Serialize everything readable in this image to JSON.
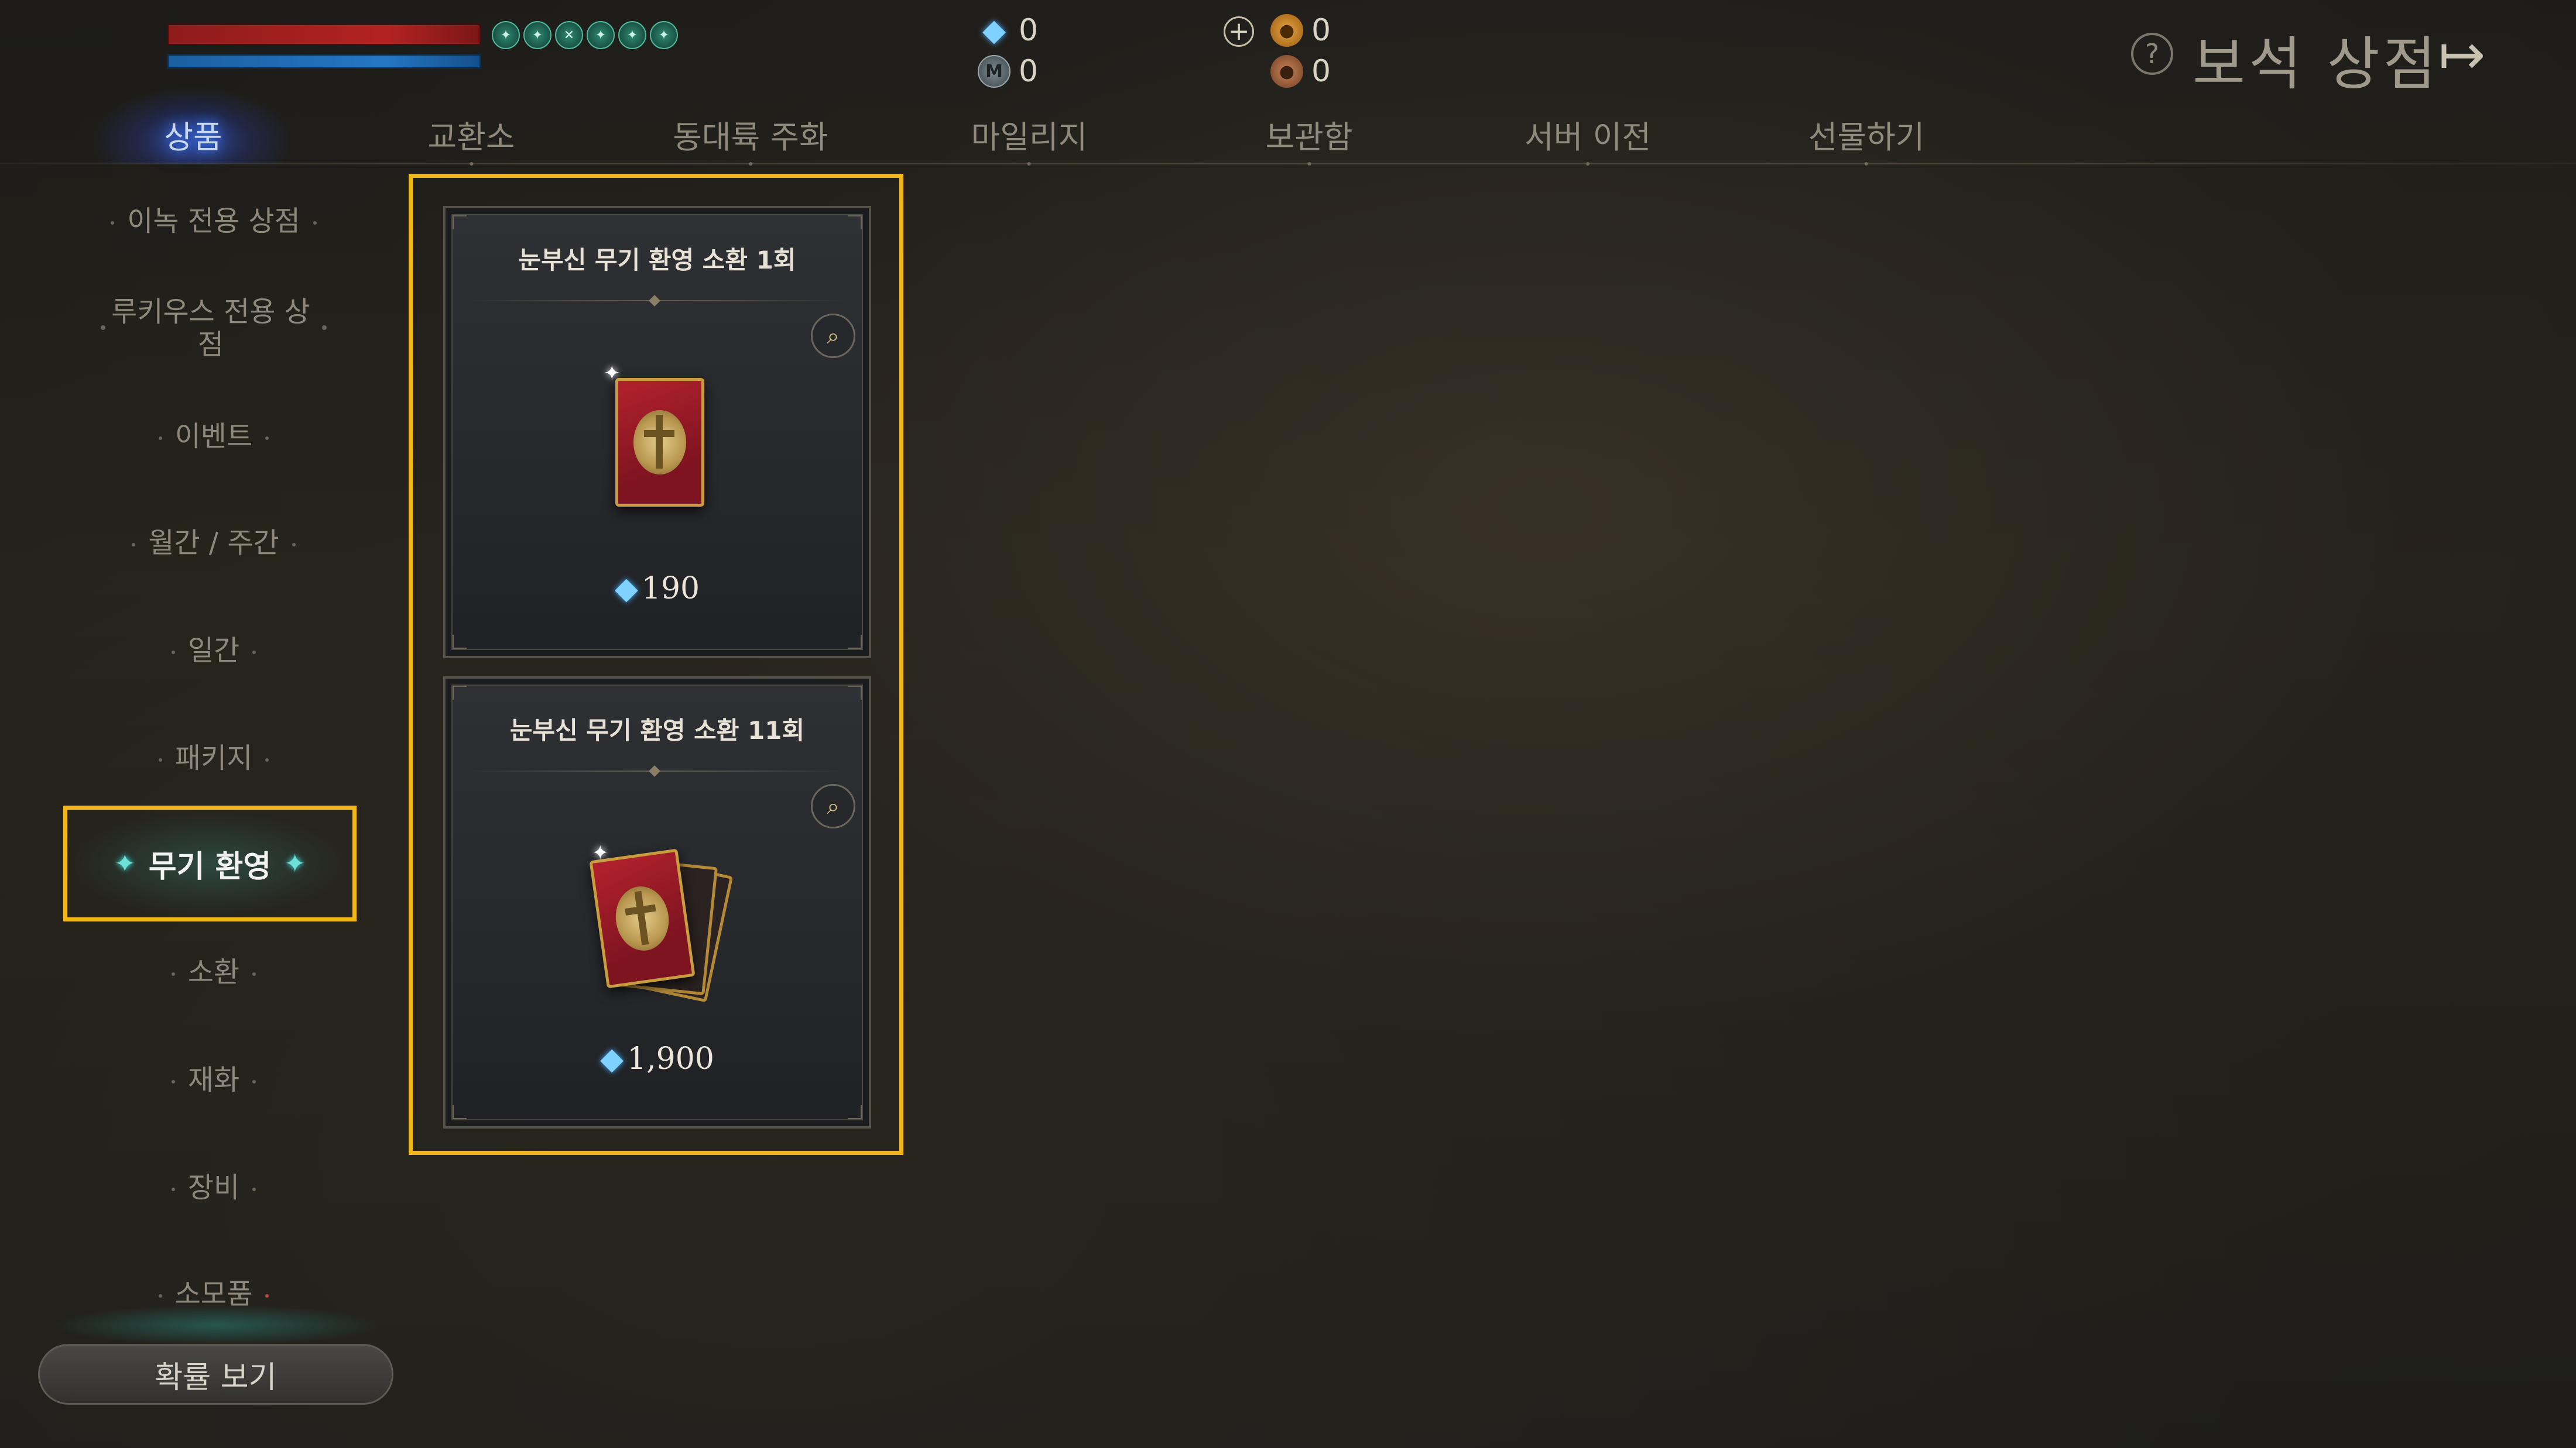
{
  "hud": {
    "buff_icons": [
      "buff-icon",
      "buff-icon",
      "buff-icon",
      "buff-icon",
      "buff-icon",
      "buff-icon"
    ]
  },
  "currency": {
    "blue_gem": "0",
    "mileage": "0",
    "gold": "0",
    "bronze": "0",
    "mileage_icon_letter": "M"
  },
  "header": {
    "help_symbol": "?",
    "title": "보석 상점",
    "exit_symbol": "↦"
  },
  "tabs": [
    {
      "label": "상품"
    },
    {
      "label": "교환소"
    },
    {
      "label": "동대륙 주화"
    },
    {
      "label": "마일리지"
    },
    {
      "label": "보관함"
    },
    {
      "label": "서버 이전"
    },
    {
      "label": "선물하기"
    }
  ],
  "sidebar": {
    "items": [
      {
        "label": "이녹 전용 상점"
      },
      {
        "label": "루키우스 전용 상점"
      },
      {
        "label": "이벤트"
      },
      {
        "label": "월간 / 주간"
      },
      {
        "label": "일간"
      },
      {
        "label": "패키지"
      },
      {
        "label": "무기 환영"
      },
      {
        "label": "소환"
      },
      {
        "label": "재화"
      },
      {
        "label": "장비"
      },
      {
        "label": "소모품"
      }
    ],
    "active_label": "무기 환영",
    "probability_button": "확률 보기"
  },
  "products": [
    {
      "name": "눈부신 무기 환영 소환 1회",
      "price": "190"
    },
    {
      "name": "눈부신 무기 환영 소환 11회",
      "price": "1,900"
    }
  ],
  "colors": {
    "highlight": "#f2b817",
    "hp": "#b32222",
    "mp": "#2476c4",
    "gem": "#7fd2ff",
    "active_tab_glow": "#3b7cff"
  }
}
